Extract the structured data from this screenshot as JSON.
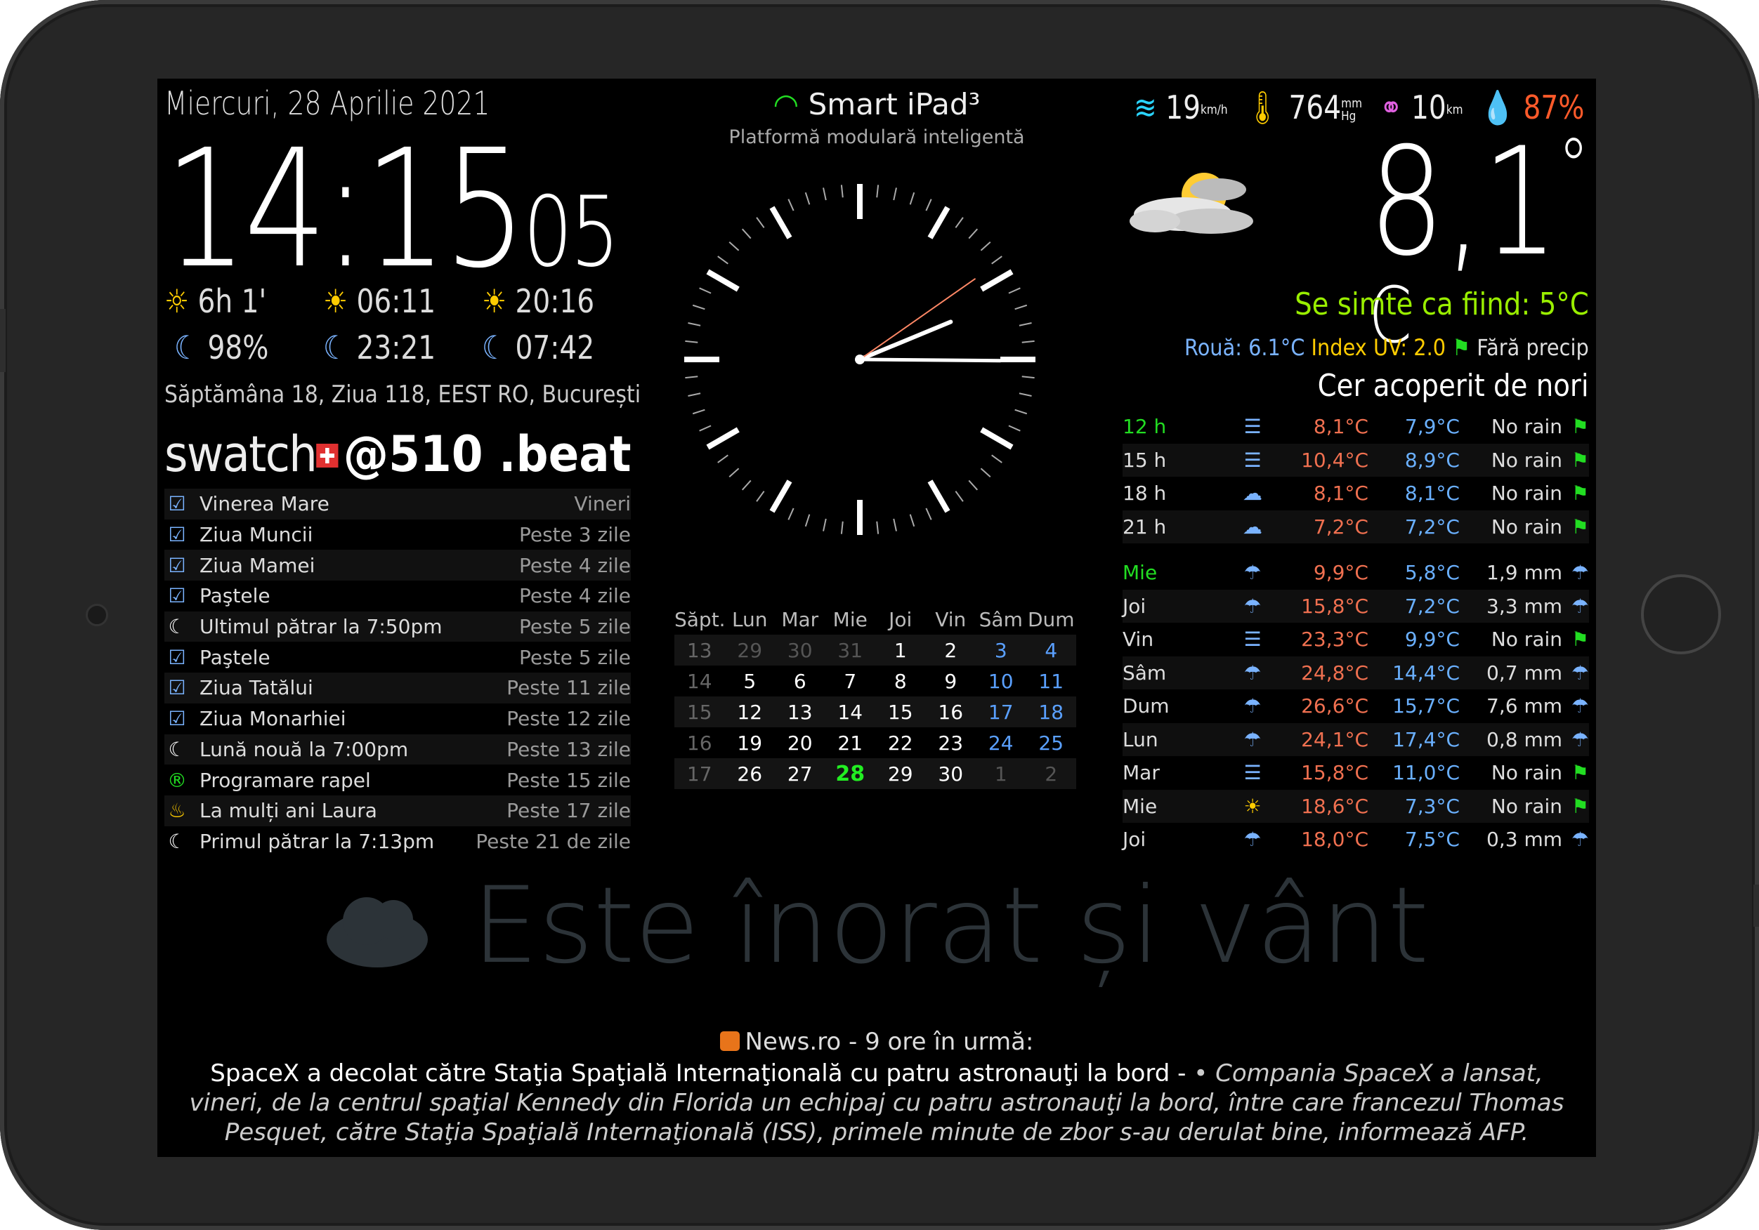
{
  "header": {
    "date": "Miercuri, 28 Aprilie 2021",
    "time_hm": "14:15",
    "time_s": "05",
    "title": "Smart iPad³",
    "subtitle": "Platformă modulară inteligentă"
  },
  "sun": {
    "daylight": "6h 1'",
    "sunrise": "06:11",
    "sunset": "20:16"
  },
  "moon": {
    "illumination": "98%",
    "moonrise": "23:21",
    "moonset": "07:42"
  },
  "week_info": "Săptămâna 18, Ziua 118, EEST RO, București",
  "swatch": {
    "brand": "swatch",
    "beat": "@510",
    "suffix": ".beat"
  },
  "events": [
    {
      "icon": "calendar-check-icon",
      "name": "Vinerea Mare",
      "when": "Vineri"
    },
    {
      "icon": "calendar-check-icon",
      "name": "Ziua Muncii",
      "when": "Peste 3 zile"
    },
    {
      "icon": "calendar-check-icon",
      "name": "Ziua Mamei",
      "when": "Peste 4 zile"
    },
    {
      "icon": "calendar-check-icon",
      "name": "Paştele",
      "when": "Peste 4 zile"
    },
    {
      "icon": "moon-icon",
      "name": "Ultimul pătrar la 7:50pm",
      "when": "Peste 5 zile"
    },
    {
      "icon": "calendar-check-icon",
      "name": "Paştele",
      "when": "Peste 5 zile"
    },
    {
      "icon": "calendar-check-icon",
      "name": "Ziua Tatălui",
      "when": "Peste 11 zile"
    },
    {
      "icon": "calendar-check-icon",
      "name": "Ziua Monarhiei",
      "when": "Peste 12 zile"
    },
    {
      "icon": "moon-icon",
      "name": "Lună nouă la 7:00pm",
      "when": "Peste 13 zile"
    },
    {
      "icon": "registered-icon",
      "name": "Programare rapel",
      "when": "Peste 15 zile"
    },
    {
      "icon": "birthday-cake-icon",
      "name": "La mulți ani Laura",
      "when": "Peste 17 zile"
    },
    {
      "icon": "moon-icon",
      "name": "Primul pătrar la 7:13pm",
      "when": "Peste 21 de zile"
    }
  ],
  "clock": {
    "hours": 14,
    "minutes": 15,
    "seconds": 5
  },
  "calendar": {
    "headers": [
      "Săpt.",
      "Lun",
      "Mar",
      "Mie",
      "Joi",
      "Vin",
      "Sâm",
      "Dum"
    ],
    "weeks": [
      {
        "wk": "13",
        "days": [
          "29",
          "30",
          "31",
          "1",
          "2",
          "3",
          "4"
        ],
        "other": [
          true,
          true,
          true,
          false,
          false,
          false,
          false
        ]
      },
      {
        "wk": "14",
        "days": [
          "5",
          "6",
          "7",
          "8",
          "9",
          "10",
          "11"
        ],
        "other": [
          false,
          false,
          false,
          false,
          false,
          false,
          false
        ]
      },
      {
        "wk": "15",
        "days": [
          "12",
          "13",
          "14",
          "15",
          "16",
          "17",
          "18"
        ],
        "other": [
          false,
          false,
          false,
          false,
          false,
          false,
          false
        ]
      },
      {
        "wk": "16",
        "days": [
          "19",
          "20",
          "21",
          "22",
          "23",
          "24",
          "25"
        ],
        "other": [
          false,
          false,
          false,
          false,
          false,
          false,
          false
        ]
      },
      {
        "wk": "17",
        "days": [
          "26",
          "27",
          "28",
          "29",
          "30",
          "1",
          "2"
        ],
        "other": [
          false,
          false,
          false,
          false,
          false,
          true,
          true
        ]
      }
    ],
    "today": "28"
  },
  "weather": {
    "wind": "19",
    "wind_unit": "km/h",
    "pressure": "764",
    "pressure_unit_top": "mm",
    "pressure_unit_bottom": "Hg",
    "visibility": "10",
    "visibility_unit": "km",
    "humidity": "87%",
    "temp": "8,1",
    "temp_deg": "°",
    "temp_unit": "C",
    "feels_like": "Se simte ca fiind: 5°C",
    "dew": "Rouă: 6.1°C",
    "uv": "Index UV: 2.0",
    "precip": "Fără precip",
    "condition": "Cer acoperit de nori",
    "colors": {
      "feels": "#99ee00",
      "humidity": "#ff5a2a",
      "uv": "#ffcc00",
      "dew": "#7ab3ff"
    }
  },
  "forecast_hourly": [
    {
      "label": "12 h",
      "icon": "fog-icon",
      "hi": "8,1°C",
      "lo": "7,9°C",
      "precip": "No rain",
      "marker": "flag-icon",
      "current": true
    },
    {
      "label": "15 h",
      "icon": "fog-icon",
      "hi": "10,4°C",
      "lo": "8,9°C",
      "precip": "No rain",
      "marker": "flag-icon"
    },
    {
      "label": "18 h",
      "icon": "cloud-icon",
      "hi": "8,1°C",
      "lo": "8,1°C",
      "precip": "No rain",
      "marker": "flag-icon"
    },
    {
      "label": "21 h",
      "icon": "cloud-icon",
      "hi": "7,2°C",
      "lo": "7,2°C",
      "precip": "No rain",
      "marker": "flag-icon"
    }
  ],
  "forecast_daily": [
    {
      "label": "Mie",
      "icon": "rain-icon",
      "hi": "9,9°C",
      "lo": "5,8°C",
      "precip": "1,9 mm",
      "marker": "umbrella-icon",
      "current": true
    },
    {
      "label": "Joi",
      "icon": "rain-icon",
      "hi": "15,8°C",
      "lo": "7,2°C",
      "precip": "3,3 mm",
      "marker": "umbrella-icon",
      "highlight": true
    },
    {
      "label": "Vin",
      "icon": "fog-icon",
      "hi": "23,3°C",
      "lo": "9,9°C",
      "precip": "No rain",
      "marker": "flag-icon"
    },
    {
      "label": "Sâm",
      "icon": "rain-icon",
      "hi": "24,8°C",
      "lo": "14,4°C",
      "precip": "0,7 mm",
      "marker": "umbrella-icon"
    },
    {
      "label": "Dum",
      "icon": "rain-icon",
      "hi": "26,6°C",
      "lo": "15,7°C",
      "precip": "7,6 mm",
      "marker": "umbrella-icon"
    },
    {
      "label": "Lun",
      "icon": "rain-icon",
      "hi": "24,1°C",
      "lo": "17,4°C",
      "precip": "0,8 mm",
      "marker": "umbrella-icon"
    },
    {
      "label": "Mar",
      "icon": "fog-icon",
      "hi": "15,8°C",
      "lo": "11,0°C",
      "precip": "No rain",
      "marker": "flag-icon"
    },
    {
      "label": "Mie",
      "icon": "sun-icon",
      "hi": "18,6°C",
      "lo": "7,3°C",
      "precip": "No rain",
      "marker": "flag-icon"
    },
    {
      "label": "Joi",
      "icon": "rain-icon",
      "hi": "18,0°C",
      "lo": "7,5°C",
      "precip": "0,3 mm",
      "marker": "umbrella-icon"
    }
  ],
  "compliment": "Este înorat și vânt",
  "news": {
    "source": "News.ro",
    "ago": " - 9 ore în urmă:",
    "headline": "SpaceX a decolat către Staţia Spaţială Internaţională cu patru astronauţi la bord - ",
    "description": "• Compania SpaceX a lansat, vineri, de la centrul spaţial Kennedy din Florida un echipaj cu patru astronauţi la bord, între care francezul Thomas Pesquet, către Staţia Spaţială Internaţională (ISS), primele minute de zbor s-au derulat bine, informează AFP."
  }
}
